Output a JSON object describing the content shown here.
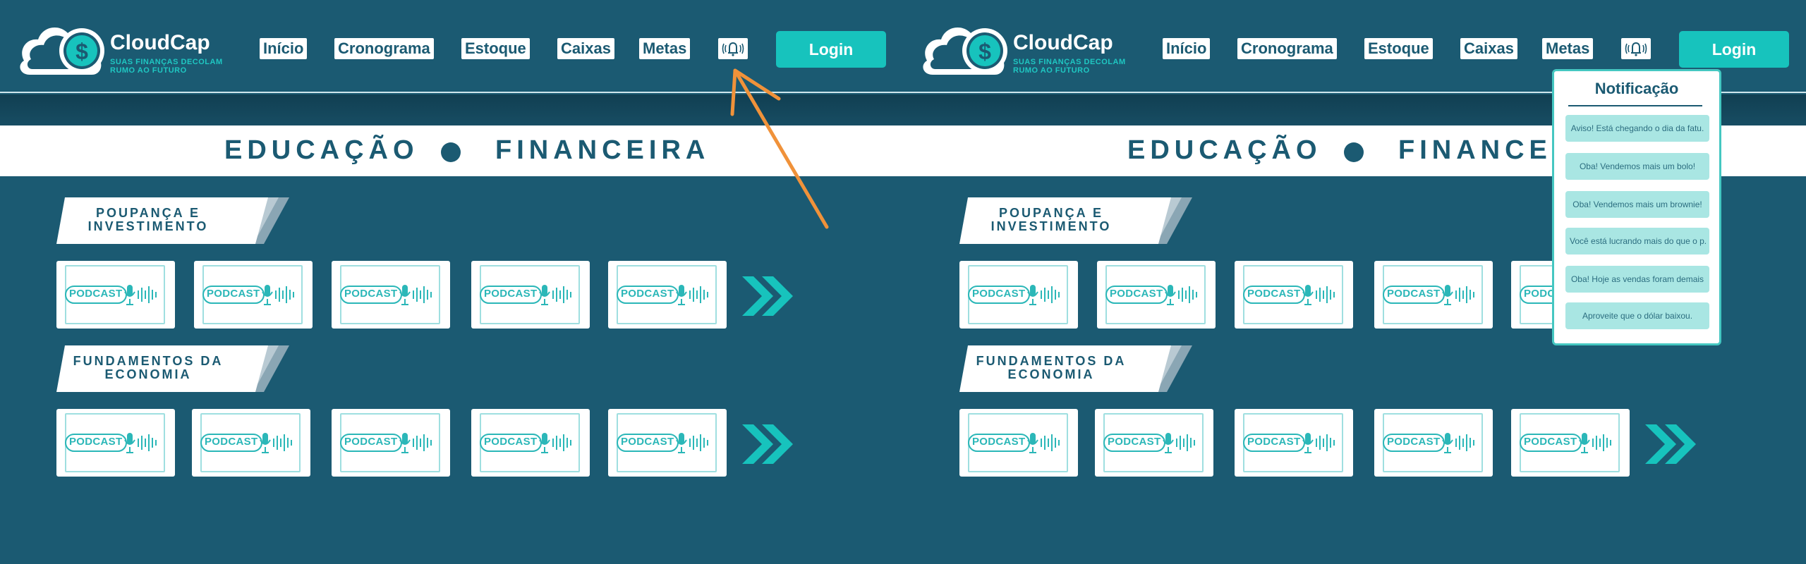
{
  "brand": {
    "name": "CloudCap",
    "tagline_line1": "SUAS FINANÇAS DECOLAM",
    "tagline_line2": "RUMO AO FUTURO"
  },
  "nav": {
    "items": [
      "Início",
      "Cronograma",
      "Estoque",
      "Caixas",
      "Metas"
    ],
    "login": "Login"
  },
  "banner": {
    "left": "EDUCAÇÃO",
    "right": "FINANCEIRA",
    "right_partial": "FINANCE"
  },
  "sections": [
    {
      "line1": "POUPANÇA E",
      "line2": "INVESTIMENTO"
    },
    {
      "line1": "FUNDAMENTOS DA",
      "line2": "ECONOMIA"
    }
  ],
  "card_label": "PODCAST",
  "notification": {
    "title": "Notificação",
    "items": [
      "Aviso! Está chegando o dia da fatu.",
      "Oba! Vendemos mais um bolo!",
      "Oba! Vendemos mais um brownie!",
      "Você está lucrando mais do que o p.",
      "Oba! Hoje as vendas foram demais",
      "Aproveite que o dólar baixou."
    ]
  },
  "colors": {
    "background": "#1b5a72",
    "accent": "#17c3bd",
    "arrow": "#f0923a"
  },
  "icons": {
    "logo": "cloud-dollar-icon",
    "notification": "bell-icon",
    "microphone": "microphone-icon",
    "next": "double-chevron-right-icon"
  }
}
